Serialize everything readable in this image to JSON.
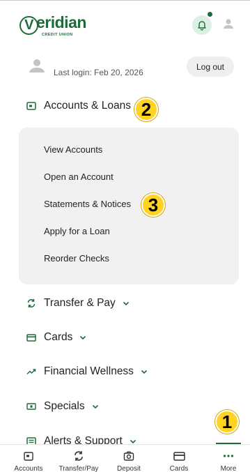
{
  "brand": {
    "name": "eridian",
    "initial": "V",
    "tagline": "CREDIT UNION",
    "color": "#1e6b3a"
  },
  "header": {
    "bell_icon": "bell-icon",
    "user_icon": "user-icon"
  },
  "profile": {
    "last_login": "Last login: Feb 20, 2026",
    "logout_label": "Log out"
  },
  "menu": {
    "accounts": {
      "label": "Accounts & Loans",
      "icon": "account-card-icon"
    },
    "submenu": [
      {
        "label": "View Accounts"
      },
      {
        "label": "Open an Account"
      },
      {
        "label": "Statements & Notices"
      },
      {
        "label": "Apply for a Loan"
      },
      {
        "label": "Reorder Checks"
      }
    ],
    "transfer": {
      "label": "Transfer & Pay",
      "icon": "transfer-icon"
    },
    "cards": {
      "label": "Cards",
      "icon": "card-icon"
    },
    "wellness": {
      "label": "Financial Wellness",
      "icon": "trend-up-icon"
    },
    "specials": {
      "label": "Specials",
      "icon": "dollar-bill-icon"
    },
    "alerts": {
      "label": "Alerts & Support",
      "icon": "alerts-icon"
    }
  },
  "callouts": [
    "1",
    "2",
    "3"
  ],
  "bottom_nav": [
    {
      "label": "Accounts",
      "icon": "accounts-icon"
    },
    {
      "label": "Transfer/Pay",
      "icon": "transfer-icon"
    },
    {
      "label": "Deposit",
      "icon": "camera-icon"
    },
    {
      "label": "Cards",
      "icon": "card-icon"
    },
    {
      "label": "More",
      "icon": "more-dots-icon"
    }
  ]
}
